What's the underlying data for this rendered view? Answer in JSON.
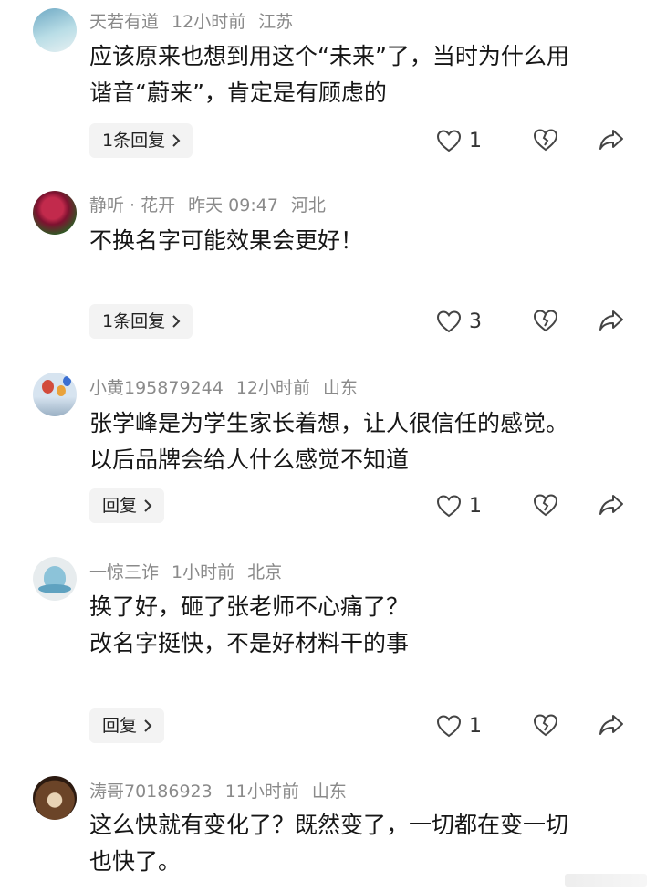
{
  "comments": [
    {
      "user": "天若有道",
      "time": "12小时前",
      "location": "江苏",
      "lines": [
        "应该原来也想到用这个“未来”了，当时为什么用",
        "谐音“蔚来”，肯定是有顾虑的"
      ],
      "reply_label": "1条回复",
      "likes": "1",
      "avatar_colors": [
        "#8fc3d6",
        "#b8dbe3"
      ]
    },
    {
      "user": "静听 · 花开",
      "time": "昨天 09:47",
      "location": "河北",
      "lines": [
        "不换名字可能效果会更好！"
      ],
      "reply_label": "1条回复",
      "likes": "3",
      "avatar_colors": [
        "#8b1530",
        "#3e6b2e"
      ]
    },
    {
      "user": "小黄195879244",
      "time": "12小时前",
      "location": "山东",
      "lines": [
        "张学峰是为学生家长着想，让人很信任的感觉。",
        "以后品牌会给人什么感觉不知道"
      ],
      "reply_label": "回复",
      "likes": "1",
      "avatar_colors": [
        "#c9d9ea",
        "#d04a3a"
      ]
    },
    {
      "user": "一惊三诈",
      "time": "1小时前",
      "location": "北京",
      "lines": [
        "换了好，砸了张老师不心痛了？",
        "改名字挺快，不是好材料干的事"
      ],
      "reply_label": "回复",
      "likes": "1",
      "avatar_colors": [
        "#dfe6ea",
        "#7fb6cf"
      ]
    },
    {
      "user": "涛哥70186923",
      "time": "11小时前",
      "location": "山东",
      "lines": [
        "这么快就有变化了？既然变了，一切都在变一切",
        "也快了。"
      ],
      "reply_label": "",
      "likes": "",
      "avatar_colors": [
        "#5a3a22",
        "#c9a27a"
      ]
    }
  ],
  "icons": {
    "like": "heart-outline-icon",
    "dislike": "broken-heart-icon",
    "share": "share-arrow-icon"
  },
  "colors": {
    "meta": "#8a8a8a",
    "text": "#161616",
    "reply_bg": "#f3f3f3"
  }
}
